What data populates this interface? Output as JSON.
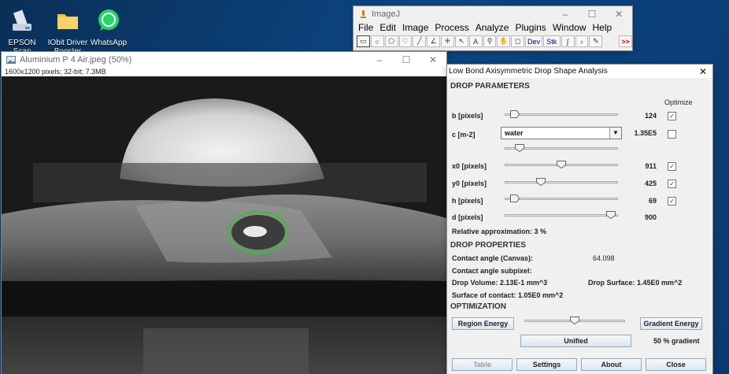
{
  "desktop": {
    "icons": [
      {
        "label": "EPSON Scan",
        "icon": "scanner-icon"
      },
      {
        "label": "IObit Driver Booster PR...",
        "icon": "folder-icon"
      },
      {
        "label": "WhatsApp",
        "icon": "whatsapp-icon"
      }
    ]
  },
  "imagej": {
    "title": "ImageJ",
    "menu": [
      "File",
      "Edit",
      "Image",
      "Process",
      "Analyze",
      "Plugins",
      "Window",
      "Help"
    ],
    "tools": [
      "rectangle-tool",
      "oval-tool",
      "polygon-tool",
      "freehand-tool",
      "line-tool",
      "angle-tool",
      "point-tool",
      "wand-tool",
      "text-tool",
      "zoom-tool",
      "hand-tool",
      "color-picker-tool",
      "dev-tool",
      "stk-tool",
      "brush-tool",
      "flood-fill-tool",
      "pencil-tool",
      "more-tools"
    ],
    "dev_label": "Dev",
    "stk_label": "Stk",
    "more_label": ">>"
  },
  "image_window": {
    "title": "Aluminium P 4 Air.jpeg (50%)",
    "info": "1600x1200 pixels; 32-bit; 7.3MB"
  },
  "dialog": {
    "title": "Low Bond Axisymmetric Drop Shape Analysis",
    "drop_parameters_heading": "DROP PARAMETERS",
    "optimize_label": "Optimize",
    "params": [
      {
        "label": "b [pixels]",
        "value": "124",
        "slider": 0.05,
        "checked": true
      },
      {
        "label": "x0 [pixels]",
        "value": "911",
        "slider": 0.5,
        "checked": true
      },
      {
        "label": "y0 [pixels]",
        "value": "425",
        "slider": 0.3,
        "checked": true
      },
      {
        "label": "h [pixels]",
        "value": "69",
        "slider": 0.05,
        "checked": true
      },
      {
        "label": "d [pixels]",
        "value": "900",
        "slider": 0.98,
        "checked": false
      }
    ],
    "c_label": "c [m-2]",
    "c_select": "water",
    "c_value": "1.35E5",
    "c_checked": false,
    "c_slider": 0.1,
    "relative_approx": "Relative approximation: 3 %",
    "drop_properties_heading": "DROP PROPERTIES",
    "contact_angle_canvas_label": "Contact angle (Canvas):",
    "contact_angle_canvas_value": "64.098",
    "contact_angle_subpixel_label": "Contact angle subpixel:",
    "drop_volume": "Drop Volume: 2.13E-1 mm^3",
    "drop_surface": "Drop Surface: 1.45E0 mm^2",
    "surface_contact": "Surface of contact: 1.05E0 mm^2",
    "optimization_heading": "OPTIMIZATION",
    "region_energy": "Region Energy",
    "gradient_energy": "Gradient Energy",
    "optimization_slider": 0.5,
    "unified": "Unified",
    "gradient_percent": "50 % gradient",
    "buttons": {
      "table": "Table",
      "settings": "Settings",
      "about": "About",
      "close": "Close"
    }
  }
}
